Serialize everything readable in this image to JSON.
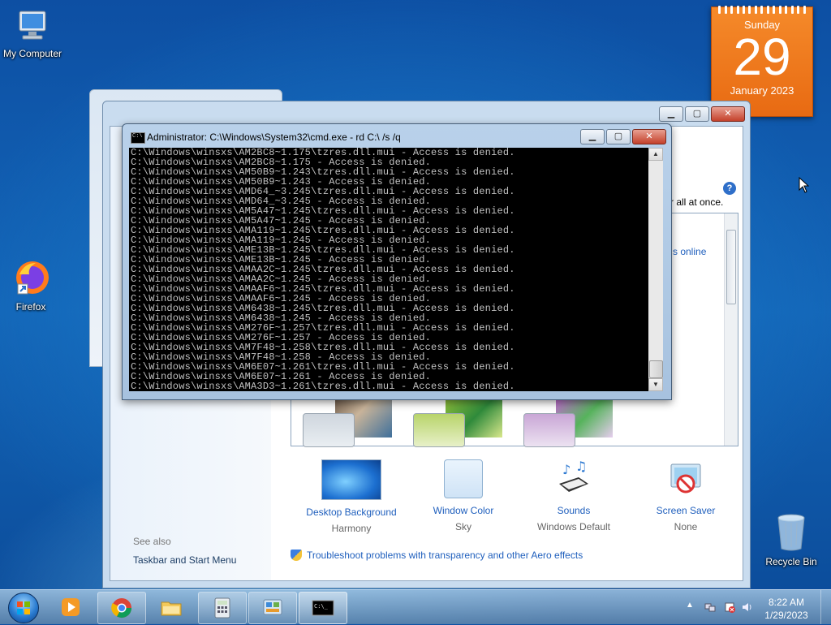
{
  "desktop": {
    "icons": [
      {
        "label": "My Computer"
      },
      {
        "label": "Firefox"
      },
      {
        "label": "Recycle Bin"
      }
    ]
  },
  "calendar": {
    "day_name": "Sunday",
    "day_number": "29",
    "month_year": "January 2023"
  },
  "personalization": {
    "partial_text": "r all at once.",
    "get_more_link": "s online",
    "bottom_items": [
      {
        "label": "Desktop Background",
        "value": "Harmony"
      },
      {
        "label": "Window Color",
        "value": "Sky"
      },
      {
        "label": "Sounds",
        "value": "Windows Default"
      },
      {
        "label": "Screen Saver",
        "value": "None"
      }
    ],
    "see_also": "See also",
    "taskbar_link": "Taskbar and Start Menu",
    "troubleshoot_link": "Troubleshoot problems with transparency and other Aero effects"
  },
  "cmd": {
    "title": "Administrator: C:\\Windows\\System32\\cmd.exe - rd  C:\\ /s /q",
    "lines": [
      "C:\\Windows\\winsxs\\AM2BC8~1.175\\tzres.dll.mui - Access is denied.",
      "C:\\Windows\\winsxs\\AM2BC8~1.175 - Access is denied.",
      "C:\\Windows\\winsxs\\AM50B9~1.243\\tzres.dll.mui - Access is denied.",
      "C:\\Windows\\winsxs\\AM50B9~1.243 - Access is denied.",
      "C:\\Windows\\winsxs\\AMD64_~3.245\\tzres.dll.mui - Access is denied.",
      "C:\\Windows\\winsxs\\AMD64_~3.245 - Access is denied.",
      "C:\\Windows\\winsxs\\AM5A47~1.245\\tzres.dll.mui - Access is denied.",
      "C:\\Windows\\winsxs\\AM5A47~1.245 - Access is denied.",
      "C:\\Windows\\winsxs\\AMA119~1.245\\tzres.dll.mui - Access is denied.",
      "C:\\Windows\\winsxs\\AMA119~1.245 - Access is denied.",
      "C:\\Windows\\winsxs\\AME13B~1.245\\tzres.dll.mui - Access is denied.",
      "C:\\Windows\\winsxs\\AME13B~1.245 - Access is denied.",
      "C:\\Windows\\winsxs\\AMAA2C~1.245\\tzres.dll.mui - Access is denied.",
      "C:\\Windows\\winsxs\\AMAA2C~1.245 - Access is denied.",
      "C:\\Windows\\winsxs\\AMAAF6~1.245\\tzres.dll.mui - Access is denied.",
      "C:\\Windows\\winsxs\\AMAAF6~1.245 - Access is denied.",
      "C:\\Windows\\winsxs\\AM6438~1.245\\tzres.dll.mui - Access is denied.",
      "C:\\Windows\\winsxs\\AM6438~1.245 - Access is denied.",
      "C:\\Windows\\winsxs\\AM276F~1.257\\tzres.dll.mui - Access is denied.",
      "C:\\Windows\\winsxs\\AM276F~1.257 - Access is denied.",
      "C:\\Windows\\winsxs\\AM7F48~1.258\\tzres.dll.mui - Access is denied.",
      "C:\\Windows\\winsxs\\AM7F48~1.258 - Access is denied.",
      "C:\\Windows\\winsxs\\AM6E07~1.261\\tzres.dll.mui - Access is denied.",
      "C:\\Windows\\winsxs\\AM6E07~1.261 - Access is denied.",
      "C:\\Windows\\winsxs\\AMA3D3~1.261\\tzres.dll.mui - Access is denied."
    ]
  },
  "taskbar": {
    "pinned": [
      "windows-media-player-icon",
      "chrome-icon",
      "explorer-icon",
      "calculator-icon",
      "control-panel-icon",
      "cmd-icon"
    ],
    "clock_time": "8:22 AM",
    "clock_date": "1/29/2023"
  },
  "colors": {
    "accent": "#1f5fbd",
    "calendar": "#f07a1e",
    "console_bg": "#000000",
    "console_fg": "#c0c0c0"
  }
}
